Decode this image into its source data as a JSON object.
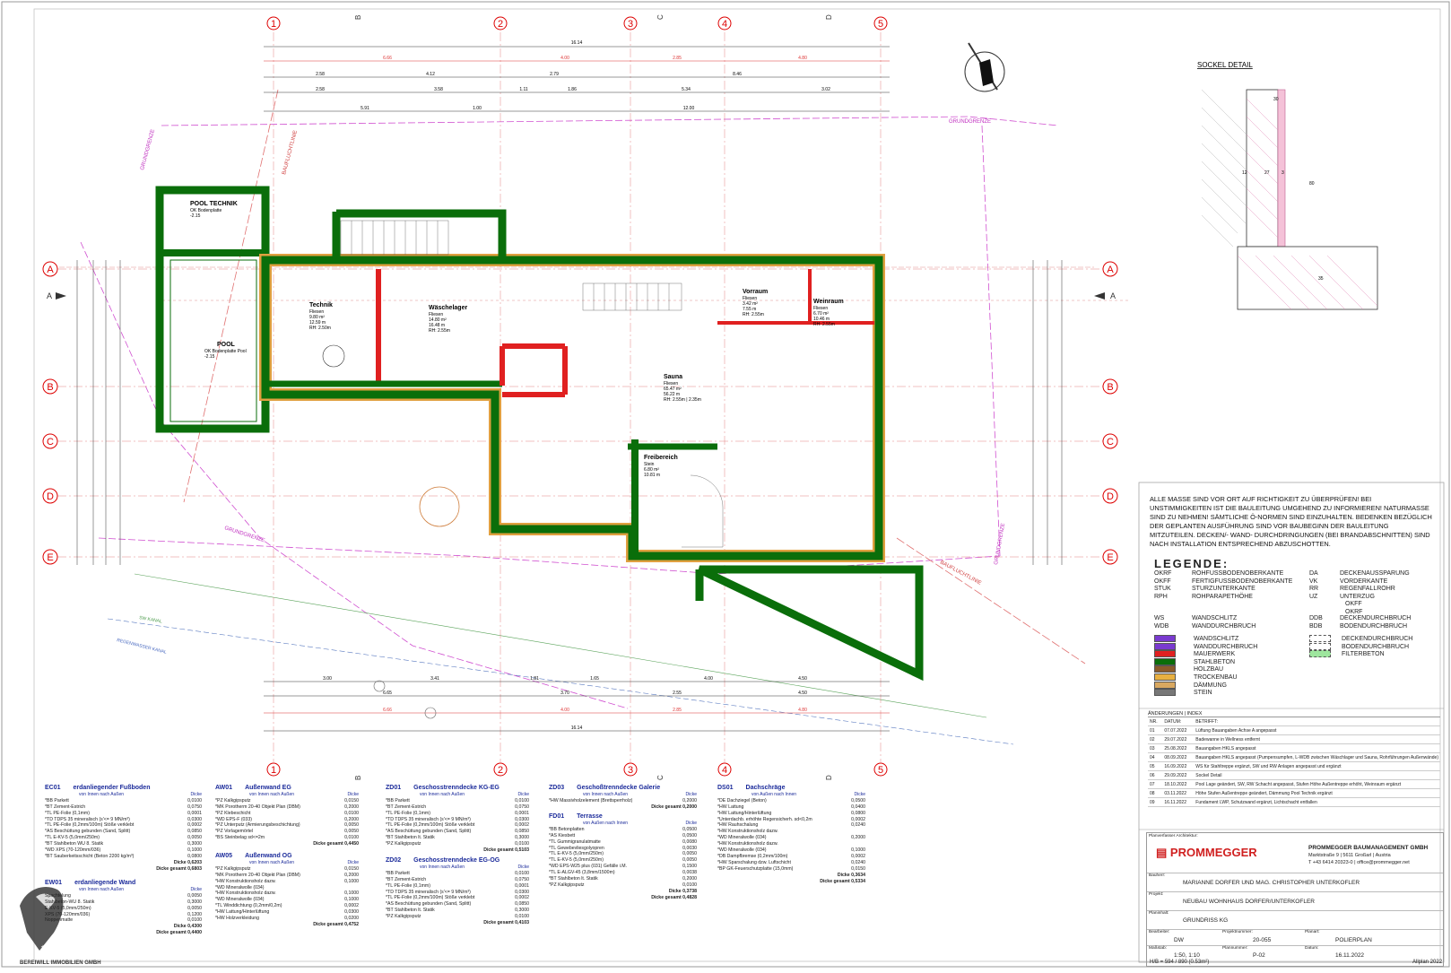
{
  "axes": {
    "numbers": [
      "1",
      "2",
      "3",
      "4",
      "5"
    ],
    "letters_top": [
      "B",
      "C",
      "D"
    ],
    "letters_side": [
      "A",
      "B",
      "C",
      "D",
      "E"
    ]
  },
  "dimensions": {
    "overall": "16.14",
    "top_row": [
      "6.66",
      "4.00",
      "2.85",
      "4.80"
    ],
    "row2": [
      "2.58",
      "4.12",
      "2.79",
      "8.46"
    ],
    "row3": [
      "2.58",
      "3.58",
      "1.11",
      "1.86",
      "5.34",
      "3.02"
    ],
    "row4": [
      "5.91",
      "1.00",
      "12.00"
    ],
    "bottom_row1": [
      "3.00",
      "3.41",
      "1.81",
      "1.65",
      "4.00",
      "4.50"
    ],
    "bottom_row2": [
      "6.65",
      "3.70",
      "2.55",
      "4.50"
    ],
    "bottom_row3": [
      "6.66",
      "4.00",
      "2.85",
      "4.80"
    ],
    "bottom_overall": "16.14"
  },
  "labels": {
    "grundgrenze": "GRUNDGRENZE",
    "baufluchtlinie": "BAUFLUCHTLINIE",
    "sw_kanal": "SW KANAL",
    "regenwasser": "REGENWASSER KANAL",
    "section": "A"
  },
  "rooms": [
    {
      "name": "POOL TECHNIK",
      "l1": "OK Bodenplatte",
      "l2": "-2.15"
    },
    {
      "name": "POOL",
      "l1": "OK Bodenplatte Pool",
      "l2": "-2.15"
    },
    {
      "name": "Technik",
      "l1": "Fliesen",
      "l2": "9.80 m²",
      "l3": "12.59 m",
      "l4": "RH: 2.50m"
    },
    {
      "name": "Wäschelager",
      "l1": "Fliesen",
      "l2": "14.80 m²",
      "l3": "16.48 m",
      "l4": "RH: 2.55m"
    },
    {
      "name": "Vorraum",
      "l1": "Fliesen",
      "l2": "3.42 m²",
      "l3": "7.55 m",
      "l4": "RH: 2.55m"
    },
    {
      "name": "Weinraum",
      "l1": "Fliesen",
      "l2": "6.70 m²",
      "l3": "10.46 m",
      "l4": "RH: 2.55m"
    },
    {
      "name": "Sauna",
      "l1": "Fliesen",
      "l2": "65.47 m²",
      "l3": "56.22 m",
      "l4": "RH: 2.55m | 2.35m"
    },
    {
      "name": "Freibereich",
      "l1": "Stein",
      "l2": "6.80 m²",
      "l3": "10.81 m"
    }
  ],
  "sockel_detail": {
    "title": "SOCKEL DETAIL",
    "d1": "30",
    "d2": "12",
    "d3": "27",
    "d4": "3",
    "d5": "80",
    "d6": "35"
  },
  "note": "ALLE MASSE SIND VOR ORT AUF RICHTIGKEIT ZU ÜBERPRÜFEN! BEI UNSTIMMIGKEITEN IST DIE BAULEITUNG UMGEHEND ZU INFORMIEREN! NATURMASSE SIND ZU NEHMEN! SÄMTLICHE Ö-NORMEN SIND EINZUHALTEN. BEDENKEN BEZÜGLICH DER GEPLANTEN AUSFÜHRUNG SIND VOR BAUBEGINN DER BAULEITUNG MITZUTEILEN. DECKEN/- WAND- DURCHDRINGUNGEN (BEI BRANDABSCHNITTEN) SIND NACH INSTALLATION ENTSPRECHEND ABZUSCHOTTEN.",
  "legend": {
    "title": "LEGENDE:",
    "abbr_left": [
      [
        "OKRF",
        "ROHFUSSBODENOBERKANTE"
      ],
      [
        "OKFF",
        "FERTIGFUSSBODENOBERKANTE"
      ],
      [
        "STUK",
        "STURZUNTERKANTE"
      ],
      [
        "RPH",
        "ROHPARAPETHÖHE"
      ]
    ],
    "abbr_right": [
      [
        "DA",
        "DECKENAUSSPARUNG"
      ],
      [
        "VK",
        "VORDERKANTE"
      ],
      [
        "RR",
        "REGENFALLROHR"
      ],
      [
        "UZ",
        "UNTERZUG"
      ],
      [
        "",
        "OKFF"
      ],
      [
        "",
        "OKRF"
      ]
    ],
    "sym_left": [
      [
        "WS",
        "WANDSCHLITZ"
      ],
      [
        "WDB",
        "WANDDURCHBRUCH"
      ]
    ],
    "sym_right": [
      [
        "DDB",
        "DECKENDURCHBRUCH"
      ],
      [
        "BDB",
        "BODENDURCHBRUCH"
      ]
    ],
    "materials": [
      {
        "label": "WANDSCHLITZ",
        "color": "#7a3ad0"
      },
      {
        "label": "WANDDURCHBRUCH",
        "color": "#7a3ad0"
      },
      {
        "label": "MAUERWERK",
        "color": "#e02020"
      },
      {
        "label": "STAHLBETON",
        "color": "#0a6e0a"
      },
      {
        "label": "HOLZBAU",
        "color": "#8a5a2a"
      },
      {
        "label": "TROCKENBAU",
        "color": "#e8b040"
      },
      {
        "label": "DÄMMUNG",
        "color": "#d9a860"
      },
      {
        "label": "STEIN",
        "color": "#777777"
      }
    ],
    "materials_right": [
      {
        "label": "DECKENDURCHBRUCH",
        "color": "#ffffff"
      },
      {
        "label": "BODENDURCHBRUCH",
        "color": "#ffffff"
      },
      {
        "label": "FILTERBETON",
        "color": "#9ee69e"
      }
    ]
  },
  "changes": {
    "title": "ÄNDERUNGEN | INDEX",
    "headers": [
      "NR.",
      "DATUM:",
      "BETRIFFT:"
    ],
    "rows": [
      [
        "01",
        "07.07.2022",
        "Lüftung Bauangaben Achse A angepasst"
      ],
      [
        "02",
        "29.07.2022",
        "Badewanne in Wellness entfernt"
      ],
      [
        "03",
        "25.08.2022",
        "Bauangaben HKLS angepasst"
      ],
      [
        "04",
        "08.09.2022",
        "Bauangaben HKLS angepasst (Pumpensumpfen, L-WDB zwischen Wäschlager und Sauna, Rohrführungen Außenwände)"
      ],
      [
        "05",
        "16.09.2022",
        "WS für Stahltreppe ergänzt, SW und RW Anlagen angepasst und ergänzt"
      ],
      [
        "06",
        "29.09.2022",
        "Sockel Detail"
      ],
      [
        "07",
        "18.10.2022",
        "Pool Lage geändert, SW, RW Schacht angepasst, Stufen Höhe Außentreppe erhöht, Weinraum ergänzt"
      ],
      [
        "08",
        "03.11.2022",
        "Höhe Stufen Außentreppe geändert, Dämmung Pool Technik ergänzt"
      ],
      [
        "09",
        "16.11.2022",
        "Fundament LWP, Schutzwand ergänzt, Lichtschacht entfallen"
      ]
    ]
  },
  "title_block": {
    "architect_label": "Planverfasser Architektur:",
    "logo": "PROMMEGGER",
    "company": "PROMMEGGER BAUMANAGEMENT GMBH",
    "address": "Marktstraße 9 | 5611 Großarl | Austria",
    "contact": "T +43 6414 20323-0 | office@prommegger.net",
    "bauherr_label": "Bauherr:",
    "bauherr": "MARIANNE DORFER UND MAG. CHRISTOPHER UNTERKOFLER",
    "projekt_label": "Projekt:",
    "projekt": "NEUBAU WOHNHAUS DORFER/UNTERKOFLER",
    "planinhalt_label": "Planinhalt:",
    "planinhalt": "GRUNDRISS KG",
    "bearbeiter_label": "Bearbeiter:",
    "bearbeiter": "DW",
    "projektnummer_label": "Projektnummer:",
    "projektnummer": "20-055",
    "planart_label": "Planart:",
    "planart": "POLIERPLAN",
    "massstab_label": "Maßstab:",
    "massstab": "1:50, 1:10",
    "plannummer_label": "Plannummer:",
    "plannummer": "P-02",
    "datum_label": "Datum:",
    "datum": "16.11.2022",
    "footer_left": "H/B = 594 / 890 (0.53m²)",
    "footer_right": "Allplan 2022"
  },
  "watermark": "BEREIWILL IMMOBILIEN GMBH",
  "sections": [
    {
      "code": "EC01",
      "title": "erdanliegender Fußboden",
      "dir": "von Innen nach Außen",
      "col": "Dicke",
      "lines": [
        [
          "*BB Parkett",
          "0,0100"
        ],
        [
          "*BT Zement-Estrich",
          "0,0750"
        ],
        [
          "*TL PE-Folie (0,1mm)",
          "0,0001"
        ],
        [
          "*TD TDPS 35 mineralisch (s'<= 9 MN/m³)",
          "0,0300"
        ],
        [
          "*TL PE-Folie (0,2mm/100m) Stöße verklebt",
          "0,0002"
        ],
        [
          "*AS Beschüttung gebunden (Sand, Splitt)",
          "0,0850"
        ],
        [
          "*TL E-KV-5 (5,0mm/250m)",
          "0,0050"
        ],
        [
          "*BT Stahlbeton WU 8. Statik",
          "0,3000"
        ],
        [
          "*WD XPS (70-120mm/036)",
          "0,1000"
        ],
        [
          "*BT Sauberkeitsschicht (Beton 2200 kg/m³)",
          "0,0800"
        ]
      ],
      "sums": [
        "Dicke 0,6203",
        "Dicke gesamt 0,6803"
      ]
    },
    {
      "code": "EW01",
      "title": "erdanliegende Wand",
      "dir": "von Innen nach Außen",
      "col": "Dicke",
      "lines": [
        [
          "Spachtelung",
          "0,0050"
        ],
        [
          "Stahlbeton-WU 8. Statik",
          "0,3000"
        ],
        [
          "E-KV-5 (5,0mm/250m)",
          "0,0050"
        ],
        [
          "XPS (70-120mm/036)",
          "0,1200"
        ],
        [
          "Noppenmatte",
          "0,0100"
        ]
      ],
      "sums": [
        "Dicke 0,4300",
        "Dicke gesamt 0,4400"
      ]
    },
    {
      "code": "AW01",
      "title": "Außenwand EG",
      "dir": "von Innen nach Außen",
      "col": "Dicke",
      "lines": [
        [
          "*PZ Kalkgipsputz",
          "0,0150"
        ],
        [
          "*MK Porotherm 20-40 Objekt Plan (DBM)",
          "0,2000"
        ],
        [
          "*PZ Klebeschicht",
          "0,0100"
        ],
        [
          "*WD EPS-F (033)",
          "0,2000"
        ],
        [
          "*PZ Unterputz (Armierungsbeschichtung)",
          "0,0050"
        ],
        [
          "*PZ Vorlagemörtel",
          "0,0050"
        ],
        [
          "*BS Steinbelag sd<=2m",
          "0,0100"
        ]
      ],
      "sums": [
        "Dicke gesamt 0,4450"
      ]
    },
    {
      "code": "AW05",
      "title": "Außenwand OG",
      "dir": "von Innen nach Außen",
      "col": "Dicke",
      "lines": [
        [
          "*PZ Kalkgipsputz",
          "0,0150"
        ],
        [
          "*MK Porotherm 20-40 Objekt Plan (DBM)",
          "0,2000"
        ],
        [
          "*HW Konstruktionsholz dazw.",
          "0,1000"
        ],
        [
          "*WD Mineralwolle (034)",
          ""
        ],
        [
          "*HW Konstruktionsholz dazw.",
          "0,1000"
        ],
        [
          "*WD Mineralwolle (034)",
          "0,1000"
        ],
        [
          "*TL Winddichtung (0,2mm/0,2m)",
          "0,0002"
        ],
        [
          "*HW Lattung/Hinterlüftung",
          "0,0300"
        ],
        [
          "*HW Holzverkleidung",
          "0,0200"
        ]
      ],
      "sums": [
        "Dicke gesamt 0,4752"
      ]
    },
    {
      "code": "ZD01",
      "title": "Geschosstrenndecke KG-EG",
      "dir": "von Innen nach Außen",
      "col": "Dicke",
      "lines": [
        [
          "*BB Parkett",
          "0,0100"
        ],
        [
          "*BT Zement-Estrich",
          "0,0750"
        ],
        [
          "*TL PE-Folie (0,1mm)",
          "0,0001"
        ],
        [
          "*TD TDPS 35 mineralisch (s'<= 9 MN/m³)",
          "0,0300"
        ],
        [
          "*TL PE-Folie (0,2mm/100m) Stöße verklebt",
          "0,0002"
        ],
        [
          "*AS Beschüttung gebunden (Sand, Splitt)",
          "0,0850"
        ],
        [
          "*BT Stahlbeton lt. Statik",
          "0,3000"
        ],
        [
          "*PZ Kalkgipsputz",
          "0,0100"
        ]
      ],
      "sums": [
        "Dicke gesamt 0,5103"
      ]
    },
    {
      "code": "ZD02",
      "title": "Geschosstrenndecke EG-OG",
      "dir": "von Innen nach Außen",
      "col": "Dicke",
      "lines": [
        [
          "*BB Parkett",
          "0,0100"
        ],
        [
          "*BT Zement-Estrich",
          "0,0750"
        ],
        [
          "*TL PE-Folie (0,1mm)",
          "0,0001"
        ],
        [
          "*TD TDPS 35 mineralisch (s'<= 9 MN/m³)",
          "0,0300"
        ],
        [
          "*TL PE-Folie (0,2mm/100m) Stöße verklebt",
          "0,0002"
        ],
        [
          "*AS Beschüttung gebunden (Sand, Splitt)",
          "0,0850"
        ],
        [
          "*BT Stahlbeton lt. Statik",
          "0,3000"
        ],
        [
          "*PZ Kalkgipsputz",
          "0,0100"
        ]
      ],
      "sums": [
        "Dicke gesamt 0,4103"
      ]
    },
    {
      "code": "ZD03",
      "title": "Geschoßtrenndecke Galerie",
      "dir": "von Innen nach Außen",
      "col": "Dicke",
      "lines": [
        [
          "*HW Massivholzelement (Brettsperrholz)",
          "0,2000"
        ]
      ],
      "sums": [
        "Dicke gesamt 0,2000"
      ]
    },
    {
      "code": "FD01",
      "title": "Terrasse",
      "dir": "von Außen nach Innen",
      "col": "Dicke",
      "lines": [
        [
          "*BB Betonplatten",
          "0,0500"
        ],
        [
          "*AS Kiesbett",
          "0,0500"
        ],
        [
          "*TL Gummigranulatmatte",
          "0,0080"
        ],
        [
          "*TL Gewebevliesgolyopren",
          "0,0030"
        ],
        [
          "*TL E-KV-5 (5,0mm/250m)",
          "0,0050"
        ],
        [
          "*TL E-KV-5 (5,0mm/250m)",
          "0,0050"
        ],
        [
          "*WD EPS-W25 plus (031) Gefälle i.M.",
          "0,1500"
        ],
        [
          "*TL E-ALGV-45 (3,8mm/1500m)",
          "0,0038"
        ],
        [
          "*BT Stahlbeton lt. Statik",
          "0,2000"
        ],
        [
          "*PZ Kalkgipsputz",
          "0,0100"
        ]
      ],
      "sums": [
        "Dicke 0,3738",
        "Dicke gesamt 0,4828"
      ]
    },
    {
      "code": "DS01",
      "title": "Dachschräge",
      "dir": "von Außen nach Innen",
      "col": "Dicke",
      "lines": [
        [
          "*DE Dachziegel (Beton)",
          "0,0500"
        ],
        [
          "*HW Lattung",
          "0,0400"
        ],
        [
          "*HW Lattung/Hinterlüftung",
          "0,0800"
        ],
        [
          "*Unterdachb. erhöhte Regensicherh. sd<0,2m",
          "0,0002"
        ],
        [
          "*HW Rauhschalung",
          "0,0240"
        ],
        [
          "*HW Konstruktionsholz dazw.",
          ""
        ],
        [
          "*WD Mineralwolle (034)",
          "0,2000"
        ],
        [
          "*HW Konstruktionsholz dazw.",
          ""
        ],
        [
          "*WD Mineralwolle (034)",
          "0,1000"
        ],
        [
          "*DB Dampfbremse (0,2mm/100m)",
          "0,0002"
        ],
        [
          "*HW Sparschalung dzw. Luftschicht",
          "0,0240"
        ],
        [
          "*BP GK-Feuerschutzplatte (15,0mm)",
          "0,0150"
        ]
      ],
      "sums": [
        "Dicke 0,3634",
        "Dicke gesamt 0,5334"
      ]
    }
  ]
}
